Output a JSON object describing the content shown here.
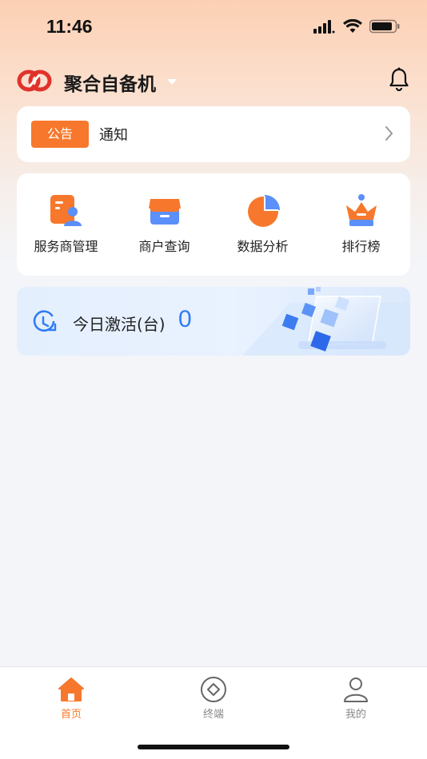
{
  "status_bar": {
    "time": "11:46"
  },
  "header": {
    "title": "聚合自备机"
  },
  "notice": {
    "badge": "公告",
    "text": "通知"
  },
  "menu": [
    {
      "label": "服务商管理",
      "icon": "provider-manage-icon"
    },
    {
      "label": "商户查询",
      "icon": "merchant-store-icon"
    },
    {
      "label": "数据分析",
      "icon": "pie-chart-icon"
    },
    {
      "label": "排行榜",
      "icon": "crown-icon"
    }
  ],
  "activation": {
    "label": "今日激活(台)",
    "value": "0"
  },
  "tabs": [
    {
      "label": "首页",
      "icon": "home-icon",
      "active": true
    },
    {
      "label": "终端",
      "icon": "terminal-icon",
      "active": false
    },
    {
      "label": "我的",
      "icon": "profile-icon",
      "active": false
    }
  ],
  "colors": {
    "accent": "#f7782c",
    "blue": "#2f7cf6",
    "logo_red": "#e0322b"
  }
}
